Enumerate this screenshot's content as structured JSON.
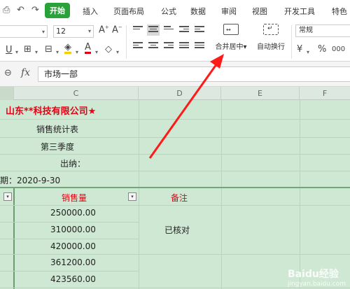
{
  "menu": {
    "items": [
      "开始",
      "插入",
      "页面布局",
      "公式",
      "数据",
      "审阅",
      "视图",
      "开发工具",
      "特色"
    ],
    "active": "开始"
  },
  "ribbon": {
    "font_size": "12",
    "merge_label": "合并居中▾",
    "wrap_label": "自动换行",
    "number_format": "常规",
    "currency": "¥",
    "percent": "%",
    "thousands": "000"
  },
  "formula_bar": {
    "fx": "fx",
    "value": "市场一部"
  },
  "columns": [
    "C",
    "D",
    "E",
    "F"
  ],
  "sheet": {
    "company": "山东**科技有限公司★",
    "report_title": "销售统计表",
    "quarter": "第三季度",
    "cashier": "出纳：",
    "date": "期：2020-9-30",
    "col_sales": "销售量",
    "col_note": "备注",
    "values": [
      "250000.00",
      "310000.00",
      "420000.00",
      "361200.00",
      "423560.00"
    ],
    "status": "已核对"
  },
  "watermark": {
    "brand": "Baidu经验",
    "sub": "jingyan.baidu.com"
  },
  "colors": {
    "accent": "#2aa23a",
    "grid": "#cfe8d3",
    "red": "#e60012"
  }
}
